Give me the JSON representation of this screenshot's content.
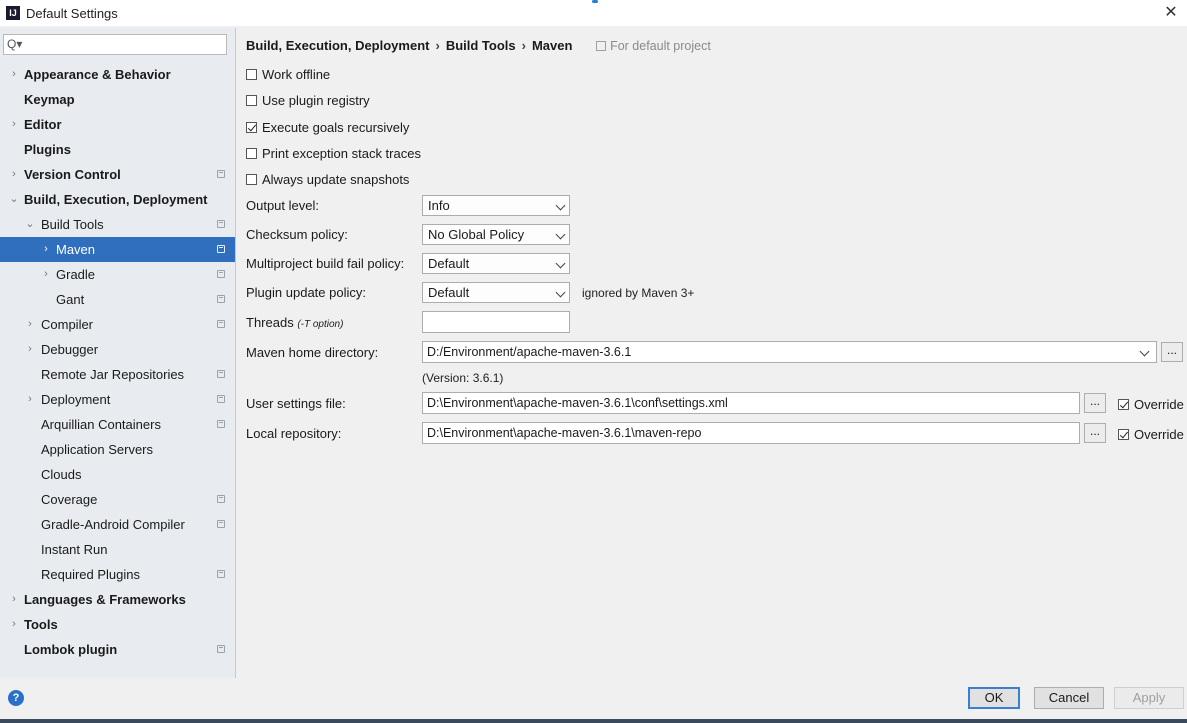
{
  "window": {
    "title": "Default Settings",
    "app_icon_text": "IJ"
  },
  "search": {
    "placeholder": "",
    "icon": "Q▾"
  },
  "sidebar": {
    "items": [
      {
        "label": "Appearance & Behavior",
        "level": 0,
        "arrow": "›",
        "bold": true
      },
      {
        "label": "Keymap",
        "level": 0,
        "arrow": "",
        "bold": true
      },
      {
        "label": "Editor",
        "level": 0,
        "arrow": "›",
        "bold": true
      },
      {
        "label": "Plugins",
        "level": 0,
        "arrow": "",
        "bold": true
      },
      {
        "label": "Version Control",
        "level": 0,
        "arrow": "›",
        "bold": true,
        "proj": true
      },
      {
        "label": "Build, Execution, Deployment",
        "level": 0,
        "arrow": "⌄",
        "bold": true
      },
      {
        "label": "Build Tools",
        "level": 1,
        "arrow": "⌄",
        "proj": true
      },
      {
        "label": "Maven",
        "level": 2,
        "arrow": "›",
        "selected": true,
        "proj": true
      },
      {
        "label": "Gradle",
        "level": 2,
        "arrow": "›",
        "proj": true
      },
      {
        "label": "Gant",
        "level": 2,
        "arrow": "",
        "proj": true
      },
      {
        "label": "Compiler",
        "level": 1,
        "arrow": "›",
        "proj": true
      },
      {
        "label": "Debugger",
        "level": 1,
        "arrow": "›"
      },
      {
        "label": "Remote Jar Repositories",
        "level": 1,
        "arrow": "",
        "proj": true
      },
      {
        "label": "Deployment",
        "level": 1,
        "arrow": "›",
        "proj": true
      },
      {
        "label": "Arquillian Containers",
        "level": 1,
        "arrow": "",
        "proj": true
      },
      {
        "label": "Application Servers",
        "level": 1,
        "arrow": ""
      },
      {
        "label": "Clouds",
        "level": 1,
        "arrow": ""
      },
      {
        "label": "Coverage",
        "level": 1,
        "arrow": "",
        "proj": true
      },
      {
        "label": "Gradle-Android Compiler",
        "level": 1,
        "arrow": "",
        "proj": true
      },
      {
        "label": "Instant Run",
        "level": 1,
        "arrow": ""
      },
      {
        "label": "Required Plugins",
        "level": 1,
        "arrow": "",
        "proj": true
      },
      {
        "label": "Languages & Frameworks",
        "level": 0,
        "arrow": "›",
        "bold": true
      },
      {
        "label": "Tools",
        "level": 0,
        "arrow": "›",
        "bold": true
      },
      {
        "label": "Lombok plugin",
        "level": 0,
        "arrow": "",
        "bold": true,
        "proj": true
      }
    ]
  },
  "breadcrumb": {
    "part1": "Build, Execution, Deployment",
    "part2": "Build Tools",
    "part3": "Maven",
    "sep": "›",
    "scope": "For default project"
  },
  "checkboxes": [
    {
      "label": "Work offline",
      "checked": false
    },
    {
      "label": "Use plugin registry",
      "checked": false
    },
    {
      "label": "Execute goals recursively",
      "checked": true
    },
    {
      "label": "Print exception stack traces",
      "checked": false
    },
    {
      "label": "Always update snapshots",
      "checked": false
    }
  ],
  "fields": {
    "output_level": {
      "label": "Output level:",
      "value": "Info"
    },
    "checksum_policy": {
      "label": "Checksum policy:",
      "value": "No Global Policy"
    },
    "fail_policy": {
      "label": "Multiproject build fail policy:",
      "value": "Default"
    },
    "plugin_update": {
      "label": "Plugin update policy:",
      "value": "Default",
      "note": "ignored by Maven 3+"
    },
    "threads": {
      "label": "Threads",
      "hint": "(-T option)",
      "value": ""
    },
    "maven_home": {
      "label": "Maven home directory:",
      "value": "D:/Environment/apache-maven-3.6.1",
      "version": "(Version: 3.6.1)"
    },
    "user_settings": {
      "label": "User settings file:",
      "value": "D:\\Environment\\apache-maven-3.6.1\\conf\\settings.xml",
      "override_label": "Override",
      "override": true
    },
    "local_repo": {
      "label": "Local repository:",
      "value": "D:\\Environment\\apache-maven-3.6.1\\maven-repo",
      "override_label": "Override",
      "override": true
    },
    "browse_label": "..."
  },
  "footer": {
    "ok": "OK",
    "cancel": "Cancel",
    "apply": "Apply",
    "help": "?"
  },
  "colors": {
    "selection": "#2f6fbd",
    "sidebar_bg": "#e8ecf0",
    "primary_border": "#3c7fd0"
  }
}
